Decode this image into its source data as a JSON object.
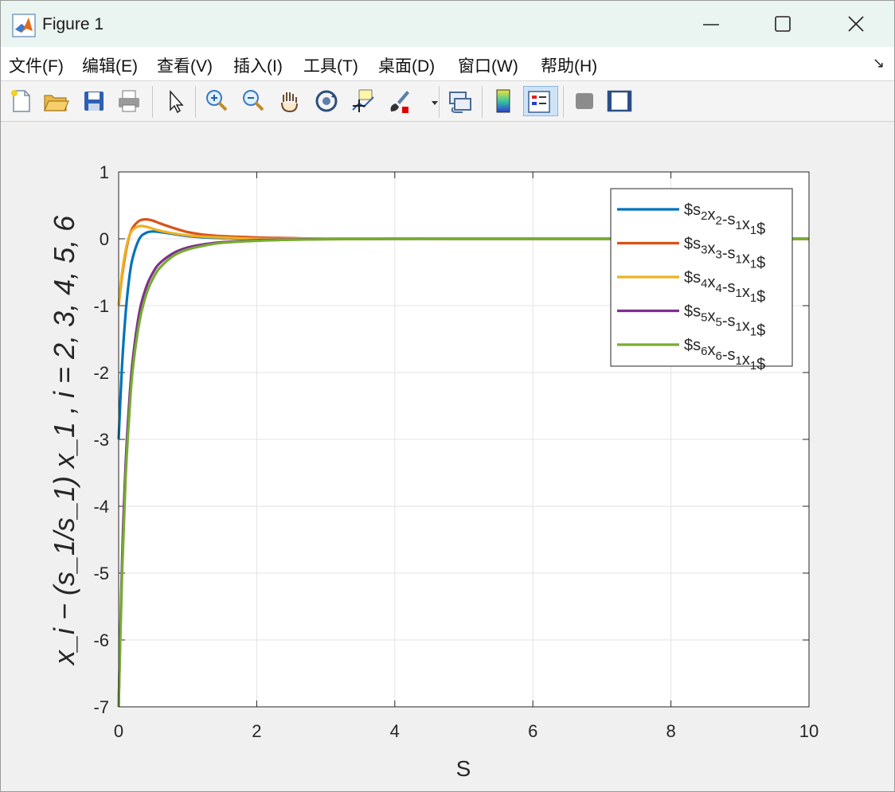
{
  "window": {
    "title": "Figure 1",
    "controls": {
      "minimize": "—",
      "maximize": "☐",
      "close": "✕"
    }
  },
  "menu": [
    "文件(F)",
    "编辑(E)",
    "查看(V)",
    "插入(I)",
    "工具(T)",
    "桌面(D)",
    "窗口(W)",
    "帮助(H)"
  ],
  "toolbar": [
    "new-figure-icon",
    "open-file-icon",
    "save-icon",
    "print-icon",
    "pointer-icon",
    "zoom-in-icon",
    "zoom-out-icon",
    "pan-hand-icon",
    "rotate-3d-icon",
    "data-cursor-icon",
    "brush-icon",
    "link-plot-icon",
    "colorbar-icon",
    "legend-icon",
    "hide-plot-tools-icon",
    "show-plot-tools-icon"
  ],
  "chart_data": {
    "type": "line",
    "xlabel": "S",
    "ylabel": "x_i − (s_1/s_1) x_1 , i = 2, 3, 4, 5, 6",
    "xlim": [
      0,
      10
    ],
    "ylim": [
      -7,
      1
    ],
    "xticks": [
      "0",
      "2",
      "4",
      "6",
      "8",
      "10"
    ],
    "yticks": [
      "-7",
      "-6",
      "-5",
      "-4",
      "-3",
      "-2",
      "-1",
      "0",
      "1"
    ],
    "grid": true,
    "legend_position": "top-right",
    "x": [
      0,
      0.05,
      0.1,
      0.15,
      0.2,
      0.3,
      0.4,
      0.5,
      0.6,
      0.8,
      1.0,
      1.25,
      1.5,
      2.0,
      2.5,
      3.0,
      4.0,
      5.0,
      6.0,
      7.0,
      8.0,
      9.0,
      10.0
    ],
    "series": [
      {
        "name": "$s2x2-s1x1$",
        "legend_parts": [
          [
            "$s",
            "2",
            "x",
            "2",
            "-s",
            "1",
            "x",
            "1",
            "$"
          ]
        ],
        "color": "#0072BD",
        "values": [
          -3.0,
          -1.88,
          -1.13,
          -0.62,
          -0.3,
          0.0,
          0.09,
          0.11,
          0.1,
          0.07,
          0.04,
          0.02,
          0.01,
          0.0,
          0.0,
          0.0,
          0.0,
          0.0,
          0.0,
          0.0,
          0.0,
          0.0,
          0.0
        ]
      },
      {
        "name": "$s3x3-s1x1$",
        "color": "#D95319",
        "values": [
          -1.0,
          -0.55,
          -0.22,
          0.02,
          0.16,
          0.27,
          0.29,
          0.27,
          0.23,
          0.16,
          0.1,
          0.06,
          0.04,
          0.02,
          0.01,
          0.0,
          0.0,
          0.0,
          0.0,
          0.0,
          0.0,
          0.0,
          0.0
        ]
      },
      {
        "name": "$s4x4-s1x1$",
        "color": "#EDB120",
        "values": [
          -1.0,
          -0.5,
          -0.18,
          0.03,
          0.13,
          0.19,
          0.18,
          0.15,
          0.12,
          0.08,
          0.05,
          0.03,
          0.02,
          0.0,
          0.0,
          0.0,
          0.0,
          0.0,
          0.0,
          0.0,
          0.0,
          0.0,
          0.0
        ]
      },
      {
        "name": "$s5x5-s1x1$",
        "color": "#7E2F8E",
        "values": [
          -7.0,
          -4.8,
          -3.4,
          -2.5,
          -1.85,
          -1.1,
          -0.72,
          -0.5,
          -0.36,
          -0.21,
          -0.13,
          -0.08,
          -0.05,
          -0.02,
          -0.01,
          -0.005,
          0.0,
          0.0,
          0.0,
          0.0,
          0.0,
          0.0,
          0.0
        ]
      },
      {
        "name": "$s6x6-s1x1$",
        "color": "#77AC30",
        "values": [
          -7.0,
          -5.0,
          -3.6,
          -2.7,
          -2.0,
          -1.25,
          -0.83,
          -0.59,
          -0.43,
          -0.25,
          -0.16,
          -0.1,
          -0.06,
          -0.03,
          -0.015,
          -0.007,
          0.0,
          0.0,
          0.0,
          0.0,
          0.0,
          0.0,
          0.0
        ]
      }
    ]
  }
}
